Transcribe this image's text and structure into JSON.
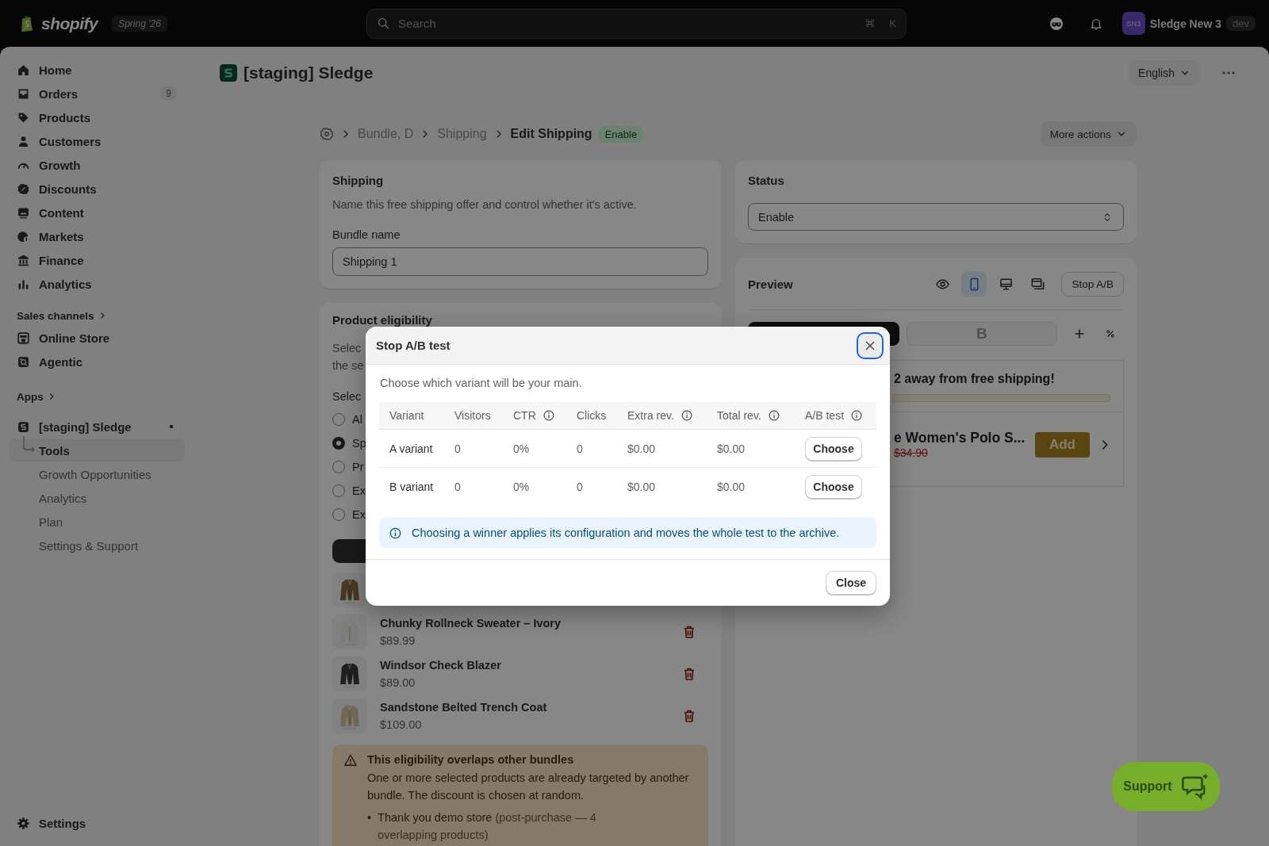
{
  "top_bar": {
    "logo": "shopify",
    "edition": "Spring '26",
    "search": {
      "placeholder": "Search",
      "shortcut": [
        "⌘",
        "K"
      ]
    },
    "account": {
      "initials": "SN3",
      "name": "Sledge New 3",
      "badge": "dev"
    }
  },
  "sidebar": {
    "items": [
      {
        "label": "Home"
      },
      {
        "label": "Orders",
        "badge": "9"
      },
      {
        "label": "Products"
      },
      {
        "label": "Customers"
      },
      {
        "label": "Growth"
      },
      {
        "label": "Discounts"
      },
      {
        "label": "Content"
      },
      {
        "label": "Markets"
      },
      {
        "label": "Finance"
      },
      {
        "label": "Analytics"
      }
    ],
    "sales_channels": {
      "label": "Sales channels",
      "items": [
        {
          "label": "Online Store"
        },
        {
          "label": "Agentic"
        }
      ]
    },
    "apps": {
      "label": "Apps",
      "items": [
        {
          "label": "[staging] Sledge",
          "children": [
            {
              "label": "Tools",
              "selected": true
            },
            {
              "label": "Growth Opportunities",
              "selected": false
            },
            {
              "label": "Analytics",
              "selected": false
            },
            {
              "label": "Plan",
              "selected": false
            },
            {
              "label": "Settings & Support",
              "selected": false
            }
          ]
        }
      ]
    },
    "settings": {
      "label": "Settings"
    }
  },
  "page_header": {
    "title": "[staging] Sledge",
    "language": "English"
  },
  "breadcrumb": {
    "items": [
      "Bundle, D",
      "Shipping"
    ],
    "current": "Edit Shipping",
    "status": "Enable",
    "more_actions": "More actions"
  },
  "shipping_card": {
    "title": "Shipping",
    "description": "Name this free shipping offer and control whether it's active.",
    "field_label": "Bundle name",
    "value": "Shipping 1"
  },
  "eligibility_card": {
    "title": "Product eligibility",
    "description": [
      "Selec",
      "the se"
    ],
    "select_label": "Selec",
    "options": [
      {
        "label": "Al",
        "selected": false
      },
      {
        "label": "Sp",
        "selected": true
      },
      {
        "label": "Pr",
        "selected": false
      },
      {
        "label": "Ex",
        "selected": false
      },
      {
        "label": "Ex",
        "selected": false
      }
    ],
    "products": [
      {
        "kind": "picture"
      },
      {
        "kind": "picture",
        "name": "Chunky Rollneck Sweater – Ivory",
        "price": "$89.99"
      },
      {
        "kind": "picture",
        "name": "Windsor Check Blazer",
        "price": "$89.00"
      },
      {
        "kind": "picture",
        "name": "Sandstone Belted Trench Coat",
        "price": "$109.00"
      }
    ],
    "warning": {
      "title": "This eligibility overlaps other bundles",
      "text": "One or more selected products are already targeted by another bundle. The discount is chosen at random.",
      "bullets": [
        {
          "marker": "•",
          "store": "Thank you demo store",
          "detail": "(post-purchase — 4 overlapping products)"
        }
      ]
    }
  },
  "status_card": {
    "title": "Status",
    "value": "Enable"
  },
  "preview_card": {
    "title": "Preview",
    "view_modes": [
      {
        "selected": false
      },
      {
        "selected": true
      },
      {
        "selected": false
      },
      {
        "selected": false
      }
    ],
    "stop_button": "Stop A/B",
    "variant_tabs": [
      {
        "selected": true
      },
      {
        "label": "B",
        "selected": false
      }
    ],
    "message": "2 away from free shipping!",
    "progress": {
      "level": 0
    },
    "product": {
      "name": "e Women's Polo S...",
      "compare_price": "$34.90",
      "button": "Add"
    }
  },
  "modal": {
    "title": "Stop A/B test",
    "intro": "Choose which variant will be your main.",
    "columns": [
      {
        "label": "Variant",
        "info": false
      },
      {
        "label": "Visitors",
        "info": false
      },
      {
        "label": "CTR",
        "info": true
      },
      {
        "label": "Clicks",
        "info": false
      },
      {
        "label": "Extra rev.",
        "info": true
      },
      {
        "label": "Total rev.",
        "info": true
      },
      {
        "label": "A/B test",
        "info": true
      }
    ],
    "rows": [
      {
        "cells": [
          "A variant",
          "0",
          "0%",
          "0",
          "$0.00",
          "$0.00"
        ],
        "action": "Choose"
      },
      {
        "cells": [
          "B variant",
          "0",
          "0%",
          "0",
          "$0.00",
          "$0.00"
        ],
        "action": "Choose"
      }
    ],
    "notice": "Choosing a winner applies its configuration and moves the whole test to the archive.",
    "close": "Close"
  },
  "support": {
    "label": "Support"
  }
}
